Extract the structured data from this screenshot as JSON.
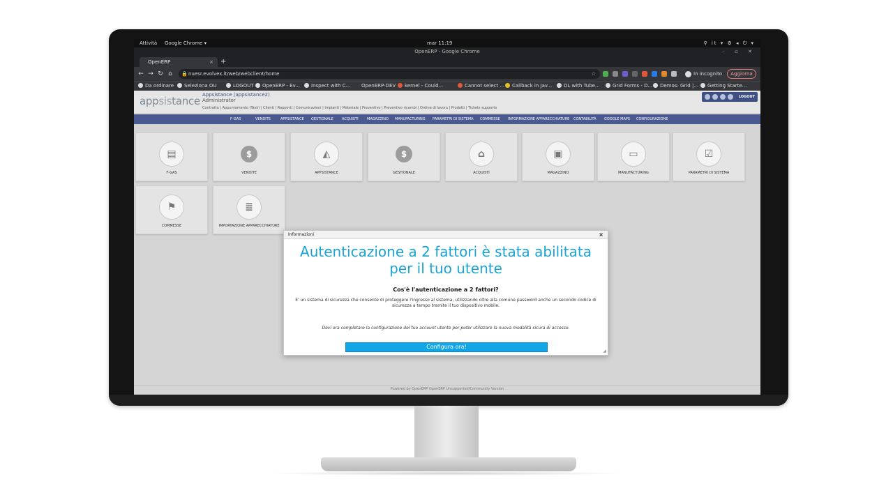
{
  "os_bar": {
    "activities": "Attività",
    "app": "Google Chrome ▾",
    "clock": "mar 11:19",
    "tray": "⚲ it ▾ ⚙ ◂ ⏻ ▾"
  },
  "chrome": {
    "window_title": "OpenERP - Google Chrome",
    "window_controls": "– ▫ ✕",
    "tab_label": "OpenERP",
    "new_tab": "+",
    "url": "nuesr.evolvex.it/web/webclient/home",
    "incognito": "In incognito",
    "update": "Aggiorna",
    "bookmarks": [
      "Da ordinare",
      "Seleziona OU",
      "LOGOUT",
      "OpenERP - Ev...",
      "Inspect with C...",
      "OpenERP-DEV",
      "kernel - Could...",
      "Cannot select ...",
      "Callback in Jav...",
      "DL with Tube...",
      "Grid Forms - D...",
      "Demos: Grid |...",
      "Getting Starte..."
    ]
  },
  "erp": {
    "logo_a": "app",
    "logo_b": "sis",
    "logo_c": "tance",
    "company_name": "Appsistance (appsistance2)",
    "user": "Administrator",
    "shortcuts": "Contratto | Appuntamento (Task) | Clienti | Rapporti | Comunicazioni | Impianti | Materiale | Preventivo | Preventivo ricambi | Ordine di lavoro | Prodotti | Tickets supporto",
    "logout": "LOGOUT",
    "menu": [
      "F-GAS",
      "VENDITE",
      "APPSISTANCE",
      "GESTIONALE",
      "ACQUISTI",
      "MAGAZZINO",
      "MANUFACTURING",
      "PARAMETRI DI SISTEMA",
      "COMMESSE",
      "INFORMAZIONE APPARECCHIATURE",
      "CONTABILITÀ",
      "GOOGLE MAPS",
      "CONFIGURAZIONE"
    ],
    "tiles": [
      {
        "label": "F-GAS",
        "icon": "fgas-icon",
        "glyph": "▤"
      },
      {
        "label": "VENDITE",
        "icon": "dollar-icon",
        "glyph": "$"
      },
      {
        "label": "APPSISTANCE",
        "icon": "appsistance-icon",
        "glyph": "◭"
      },
      {
        "label": "GESTIONALE",
        "icon": "dollar-icon",
        "glyph": "$"
      },
      {
        "label": "ACQUISTI",
        "icon": "basket-icon",
        "glyph": "⌂"
      },
      {
        "label": "MAGAZZINO",
        "icon": "box-icon",
        "glyph": "▣"
      },
      {
        "label": "MANUFACTURING",
        "icon": "monitor-icon",
        "glyph": "▭"
      },
      {
        "label": "PARAMETRI DI SISTEMA",
        "icon": "checklist-icon",
        "glyph": "☑"
      },
      {
        "label": "COMMESSE",
        "icon": "flag-icon",
        "glyph": "⚑"
      },
      {
        "label": "IMPORTAZIONE APPARECCHIATURE",
        "icon": "database-icon",
        "glyph": "≣"
      }
    ],
    "footer": "Powered by OpenERP   OpenERP   Unsupported/Community Version"
  },
  "dialog": {
    "title": "Informazioni",
    "close": "×",
    "heading": "Autenticazione a 2 fattori è stata abilitata per il tuo utente",
    "subheading": "Cos'è l'autenticazione a 2 fattori?",
    "body": "E' un sistema di sicurezza che consente di proteggere l'ingresso al sistema, utilizzando oltre alla comune password anche un secondo codice di sicurezza a tempo tramite il tuo dispositivo mobile.",
    "note": "Devi ora completare la configurazione del tuo account utente per poter utilizzare la nuova modalità sicura di accesso.",
    "button": "Configura ora!"
  },
  "colors": {
    "menubar": "#4a5a90",
    "accent": "#1aa3d7",
    "button": "#11a6e8"
  }
}
